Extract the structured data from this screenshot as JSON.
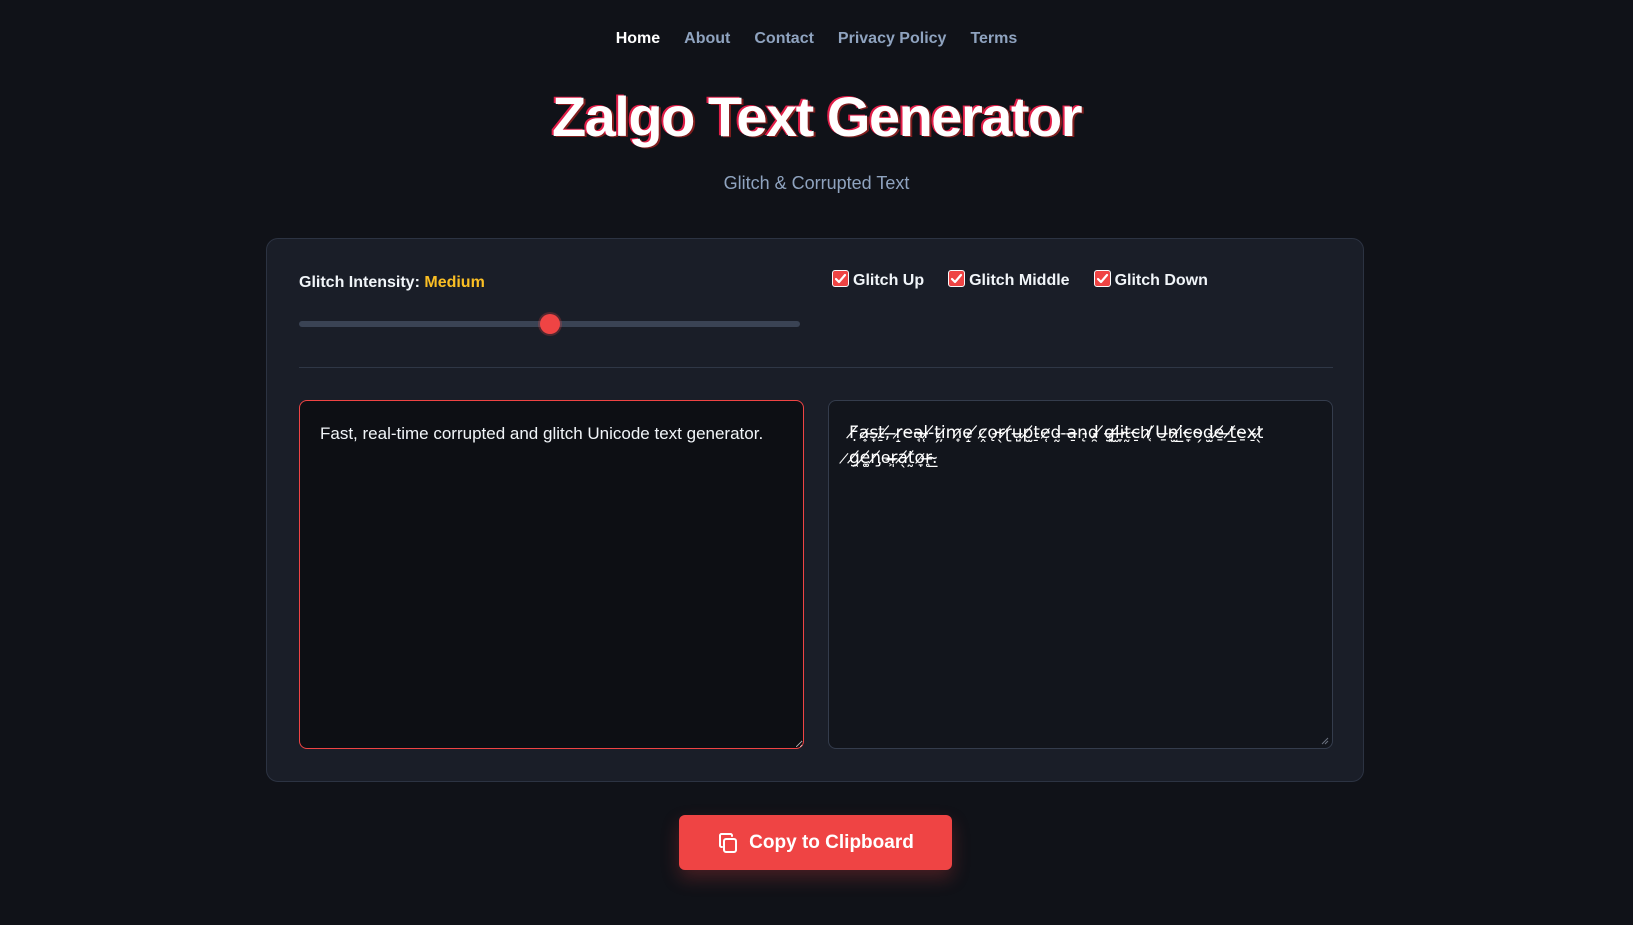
{
  "nav": {
    "items": [
      {
        "label": "Home",
        "active": true
      },
      {
        "label": "About",
        "active": false
      },
      {
        "label": "Contact",
        "active": false
      },
      {
        "label": "Privacy Policy",
        "active": false
      },
      {
        "label": "Terms",
        "active": false
      }
    ]
  },
  "header": {
    "title": "Zalgo Text Generator",
    "subtitle": "Glitch & Corrupted Text"
  },
  "controls": {
    "intensity_label": "Glitch Intensity:",
    "intensity_value": "Medium",
    "slider_fraction": 0.5,
    "checkboxes": [
      {
        "label": "Glitch Up",
        "checked": true
      },
      {
        "label": "Glitch Middle",
        "checked": true
      },
      {
        "label": "Glitch Down",
        "checked": true
      }
    ]
  },
  "input": {
    "value": "Fast, real-time corrupted and glitch Unicode text generator."
  },
  "output": {
    "value": "F̸̣a̷͎s̶̟t̵̠,̸ ̶r̷̝e̴a̴̘l̶̜-̸t̵̗i̷̦m̷̟e̵̝ ̸c̷̭ǫ̵r̴̖r̸̢u̶̺p̸̫t̵̠e̷̜d̵̰ ̵a̶̠n̵̨d̵̯ ̸g̶͓l̸̫i̶̞t̴̰c̴̠h̸͔ ̸U̶̱n̴̫i̸̲c̴̞o̴̗d̵̫e̸̱ ̶t̸̲e̴̱x̵̠t̷̖ ̷g̸̯e̸͚n̸̡e̶͕r̶̩a̸̖t̸̰o̷̞r̶̥.̴̲"
  },
  "actions": {
    "copy_label": "Copy to Clipboard"
  },
  "colors": {
    "accent": "#ef4444",
    "highlight": "#fbbf24",
    "background": "#101218"
  }
}
